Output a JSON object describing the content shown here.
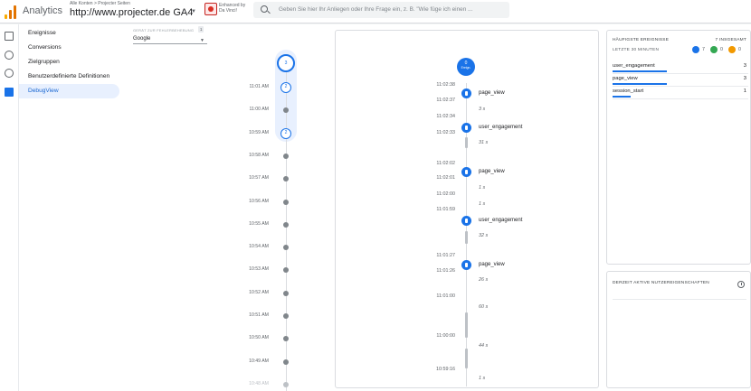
{
  "header": {
    "app_title": "Analytics",
    "breadcrumb": "Alle Konten > Projecter Seiten",
    "property_name": "http://www.projecter.de GA4",
    "extension_text": [
      "Enhanced by",
      "Da Vinci!"
    ],
    "search_placeholder": "Geben Sie hier Ihr Anliegen oder Ihre Frage ein, z. B. \"Wie füge ich einen ..."
  },
  "brand_colors": {
    "logo": [
      "#f9ab00",
      "#e37400",
      "#e37400"
    ],
    "accent": "#1a73e8"
  },
  "rail_icons": [
    "reports-icon",
    "explore-icon",
    "advertising-icon",
    "configure-icon"
  ],
  "nav": {
    "items": [
      {
        "label": "Ereignisse",
        "active": false
      },
      {
        "label": "Conversions",
        "active": false
      },
      {
        "label": "Zielgruppen",
        "active": false
      },
      {
        "label": "Benutzerdefinierte Definitionen",
        "active": false
      },
      {
        "label": "DebugView",
        "active": true
      }
    ]
  },
  "device": {
    "label": "GERÄT ZUR FEHLERBEHEBUNG",
    "count": "1",
    "selected": "Google"
  },
  "minute_timeline": {
    "top_count": "3",
    "rows": [
      {
        "time": "11:01 AM",
        "count": "2"
      },
      {
        "time": "11:00 AM",
        "count": ""
      },
      {
        "time": "10:59 AM",
        "count": "2"
      },
      {
        "time": "10:58 AM",
        "count": ""
      },
      {
        "time": "10:57 AM",
        "count": ""
      },
      {
        "time": "10:56 AM",
        "count": ""
      },
      {
        "time": "10:55 AM",
        "count": ""
      },
      {
        "time": "10:54 AM",
        "count": ""
      },
      {
        "time": "10:53 AM",
        "count": ""
      },
      {
        "time": "10:52 AM",
        "count": ""
      },
      {
        "time": "10:51 AM",
        "count": ""
      },
      {
        "time": "10:50 AM",
        "count": ""
      },
      {
        "time": "10:49 AM",
        "count": ""
      },
      {
        "time": "10:48 AM",
        "count": ""
      }
    ]
  },
  "seconds_stream": {
    "top_count": "0",
    "top_label": "Ereign.",
    "times": [
      "11:02:38",
      "11:02:37",
      "11:02:34",
      "11:02:33",
      "11:02:02",
      "11:02:01",
      "11:02:00",
      "11:01:59",
      "11:01:27",
      "11:01:26",
      "11:01:00",
      "11:00:00",
      "10:59:16"
    ],
    "events": [
      "page_view",
      "user_engagement",
      "page_view",
      "user_engagement",
      "page_view"
    ],
    "durations": [
      "3 s",
      "31 s",
      "1 s",
      "1 s",
      "32 s",
      "26 s",
      "60 s",
      "44 s",
      "1 s"
    ]
  },
  "top_events": {
    "title": "HÄUFIGSTE EREIGNISSE",
    "total": "7 INSGESAMT",
    "subtitle": "LETZTE 30 MINUTEN",
    "counts": [
      {
        "icon": "event-icon",
        "value": "7",
        "color": "#1a73e8"
      },
      {
        "icon": "conversion-icon",
        "value": "0",
        "color": "#34a853"
      },
      {
        "icon": "error-icon",
        "value": "0",
        "color": "#f29900"
      }
    ],
    "rows": [
      {
        "name": "user_engagement",
        "value": "3",
        "share": 1.0
      },
      {
        "name": "page_view",
        "value": "3",
        "share": 1.0
      },
      {
        "name": "session_start",
        "value": "1",
        "share": 0.33
      }
    ]
  },
  "user_props": {
    "title": "DERZEIT AKTIVE NUTZEREIGENSCHAFTEN"
  }
}
